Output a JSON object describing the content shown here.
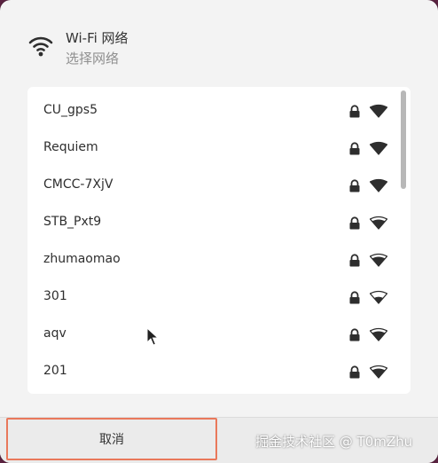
{
  "dialog": {
    "title": "Wi-Fi 网络",
    "subtitle": "选择网络"
  },
  "networks": [
    {
      "name": "CU_gps5",
      "locked": true,
      "signal": 4
    },
    {
      "name": "Requiem",
      "locked": true,
      "signal": 4
    },
    {
      "name": "CMCC-7XjV",
      "locked": true,
      "signal": 4
    },
    {
      "name": "STB_Pxt9",
      "locked": true,
      "signal": 3
    },
    {
      "name": "zhumaomao",
      "locked": true,
      "signal": 3
    },
    {
      "name": "301",
      "locked": true,
      "signal": 2
    },
    {
      "name": "aqv",
      "locked": true,
      "signal": 3
    },
    {
      "name": "201",
      "locked": true,
      "signal": 3
    }
  ],
  "footer": {
    "cancel_label": "取消",
    "watermark": "掘金技术社区 @ T0mZhu"
  },
  "colors": {
    "focus_ring": "#e9785b",
    "dialog_bg": "#f3f3f3",
    "list_bg": "#ffffff"
  },
  "icons": {
    "header": "wifi-icon",
    "lock": "lock-icon",
    "signal": "wifi-signal-icon"
  }
}
